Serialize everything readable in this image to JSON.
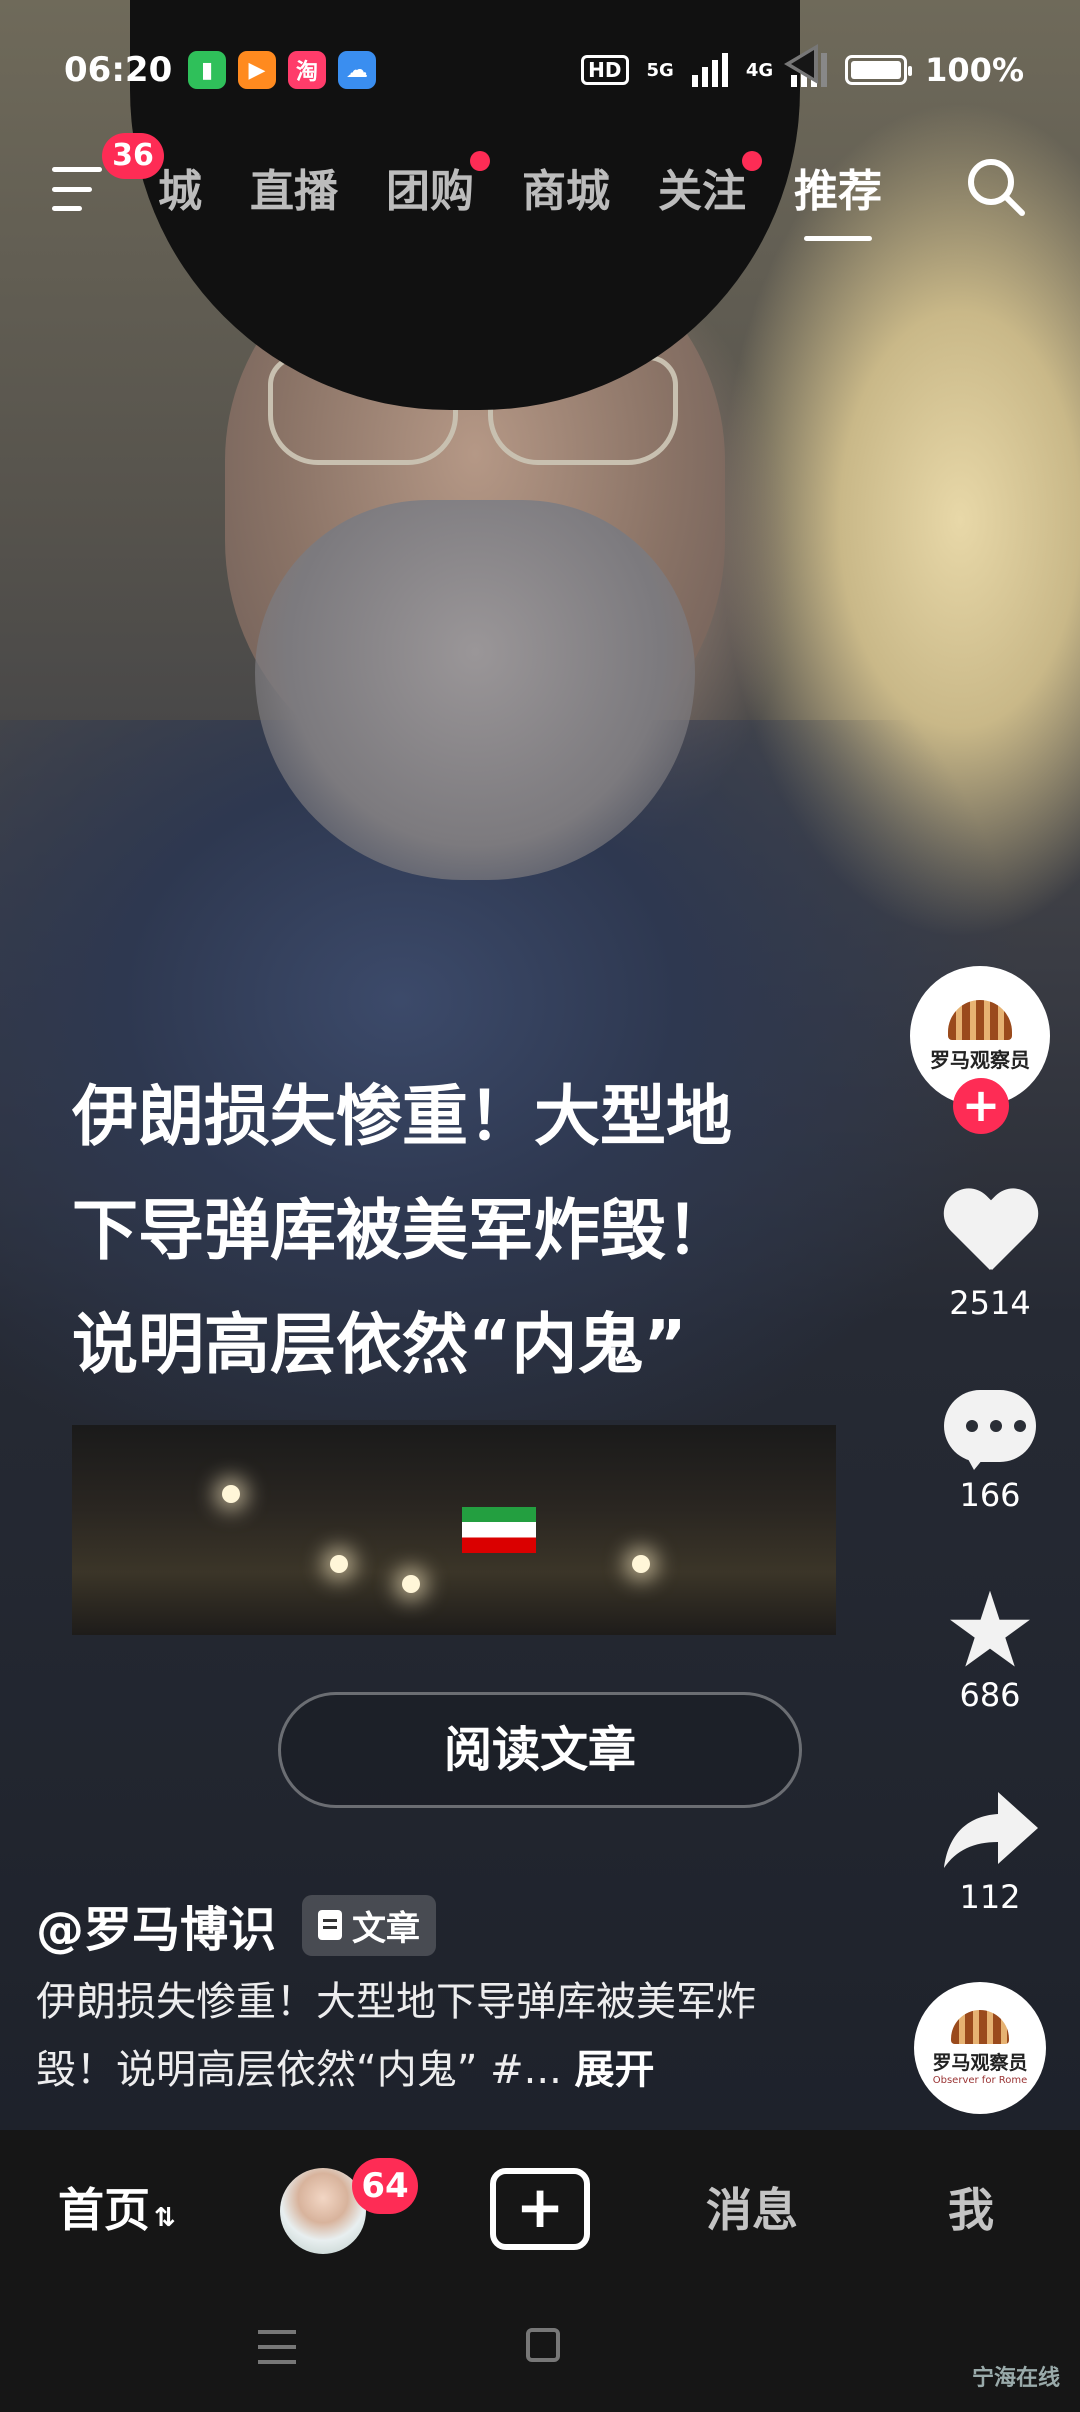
{
  "status_bar": {
    "time": "06:20",
    "network_label": "5G",
    "network_label_2": "4G",
    "hd_label": "HD",
    "battery": "100%",
    "battery_level": 1.0,
    "app_icons": [
      "battery-saver-icon",
      "video-app-icon",
      "taobao-icon",
      "weather-icon"
    ],
    "taobao_glyph": "淘"
  },
  "top_nav": {
    "menu_badge": "36",
    "tabs": [
      {
        "label": "城",
        "red_dot": false
      },
      {
        "label": "直播",
        "red_dot": false
      },
      {
        "label": "团购",
        "red_dot": true
      },
      {
        "label": "商城",
        "red_dot": false
      },
      {
        "label": "关注",
        "red_dot": true
      },
      {
        "label": "推荐",
        "red_dot": false,
        "active": true
      }
    ]
  },
  "article": {
    "title_lines": [
      "伊朗损失惨重！大型地",
      "下导弹库被美军炸毁！",
      "说明高层依然“内鬼”"
    ],
    "read_button": "阅读文章"
  },
  "author": {
    "handle": "@罗马博识",
    "tag": "文章"
  },
  "description": {
    "text": "伊朗损失惨重！大型地下导弹库被美军炸毁！说明高层依然“内鬼” #...",
    "more": "展开"
  },
  "side_actions": {
    "avatar_text": "罗马观察员",
    "avatar_subtext": "Observer for Rome",
    "follow": "+",
    "likes": "2514",
    "comments": "166",
    "favorites": "686",
    "shares": "112"
  },
  "bottom_tabs": {
    "home": "首页",
    "avatar_badge": "64",
    "plus": "+",
    "messages": "消息",
    "me": "我"
  },
  "watermark": "宁海在线",
  "colors": {
    "accent": "#fe2c55",
    "background": "#161616"
  }
}
